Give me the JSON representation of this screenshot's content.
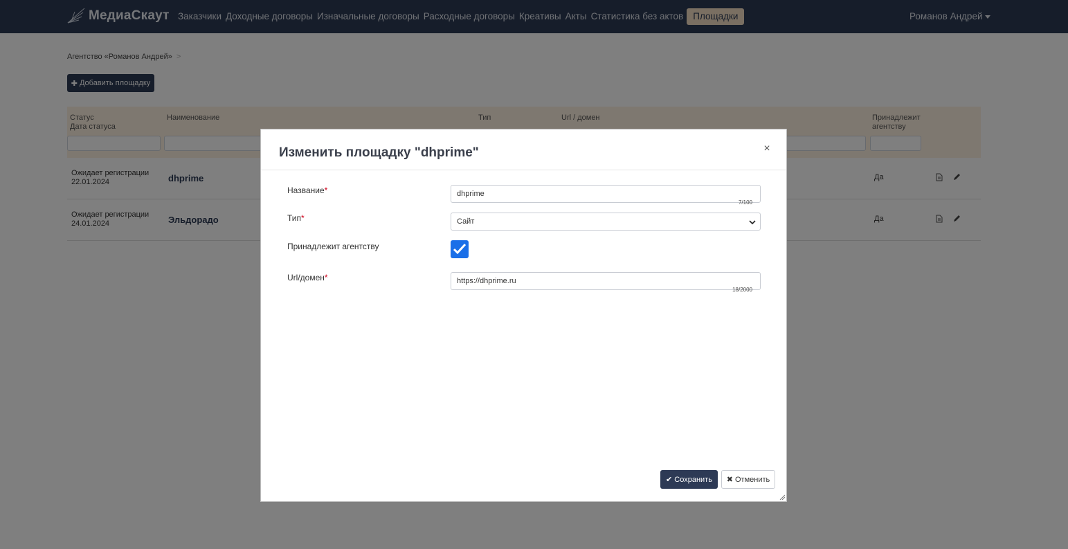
{
  "colors": {
    "navbar": "#2d3a55",
    "active_nav": "#f4dfc4",
    "primary_button": "#2d3a55",
    "checkbox": "#1a6fe8",
    "table_header": "#fdf0e0",
    "required": "#d0021b"
  },
  "brand": {
    "name": "МедиаСкаут",
    "icon": "antenna-logo-icon"
  },
  "nav": {
    "items": [
      {
        "label": "Заказчики"
      },
      {
        "label": "Доходные договоры"
      },
      {
        "label": "Изначальные договоры"
      },
      {
        "label": "Расходные договоры"
      },
      {
        "label": "Креативы"
      },
      {
        "label": "Акты"
      },
      {
        "label": "Статистика без актов"
      },
      {
        "label": "Площадки",
        "active": true
      }
    ],
    "user": "Романов Андрей"
  },
  "breadcrumb": {
    "item": "Агентство «Романов Андрей»",
    "separator": ">"
  },
  "add_button": {
    "icon": "plus-icon",
    "label": "Добавить площадку"
  },
  "table": {
    "headers": {
      "status": "Статус",
      "status_date": "Дата статуса",
      "name": "Наименование",
      "type": "Тип",
      "url": "Url / домен",
      "belongs_1": "Принадлежит",
      "belongs_2": "агентству"
    },
    "rows": [
      {
        "status": "Ожидает регистрации",
        "date": "22.01.2024",
        "name": "dhprime",
        "belongs": "Да"
      },
      {
        "status": "Ожидает регистрации",
        "date": "24.01.2024",
        "name": "Эльдорадо",
        "belongs": "Да"
      }
    ],
    "row_icons": [
      "document-icon",
      "pencil-icon"
    ]
  },
  "modal": {
    "title": "Изменить площадку \"dhprime\"",
    "close": "×",
    "fields": {
      "name": {
        "label": "Название",
        "value": "dhprime",
        "counter": "7/100"
      },
      "type": {
        "label": "Тип",
        "value": "Сайт"
      },
      "belongs": {
        "label": "Принадлежит агентству",
        "checked": true
      },
      "url": {
        "label": "Url/домен",
        "value": "https://dhprime.ru",
        "counter": "18/2000"
      }
    },
    "required_mark": "*",
    "save_label": "Сохранить",
    "cancel_label": "Отменить"
  }
}
